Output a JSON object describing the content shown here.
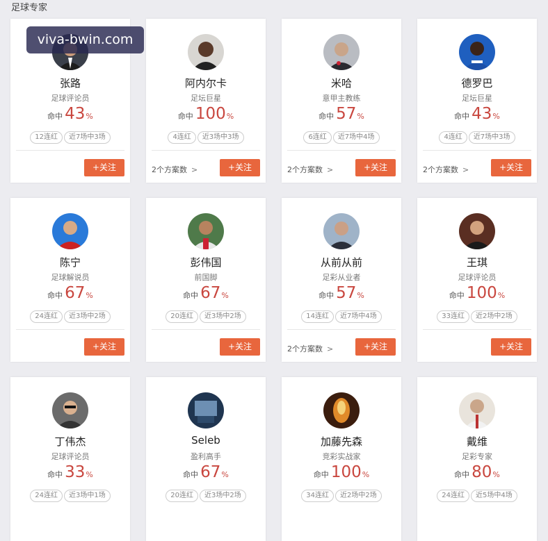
{
  "section_title": "足球专家",
  "watermark": "viva-bwin.com",
  "labels": {
    "hit": "命中",
    "percent": "%",
    "follow": "+关注",
    "plans_suffix": "个方案数"
  },
  "colors": {
    "accent_orange": "#e8663d",
    "rate_red": "#c9473f"
  },
  "experts": [
    {
      "name": "张路",
      "role": "足球评论员",
      "rate": "43",
      "streak": "12连红",
      "recent": "近7场中3场",
      "plans": ""
    },
    {
      "name": "阿内尔卡",
      "role": "足坛巨星",
      "rate": "100",
      "streak": "4连红",
      "recent": "近3场中3场",
      "plans": "2个方案数"
    },
    {
      "name": "米哈",
      "role": "意甲主教练",
      "rate": "57",
      "streak": "6连红",
      "recent": "近7场中4场",
      "plans": "2个方案数"
    },
    {
      "name": "德罗巴",
      "role": "足坛巨星",
      "rate": "43",
      "streak": "4连红",
      "recent": "近7场中3场",
      "plans": "2个方案数"
    },
    {
      "name": "陈宁",
      "role": "足球解说员",
      "rate": "67",
      "streak": "24连红",
      "recent": "近3场中2场",
      "plans": ""
    },
    {
      "name": "彭伟国",
      "role": "前国脚",
      "rate": "67",
      "streak": "20连红",
      "recent": "近3场中2场",
      "plans": ""
    },
    {
      "name": "从前从前",
      "role": "足彩从业者",
      "rate": "57",
      "streak": "14连红",
      "recent": "近7场中4场",
      "plans": "2个方案数"
    },
    {
      "name": "王琪",
      "role": "足球评论员",
      "rate": "100",
      "streak": "33连红",
      "recent": "近2场中2场",
      "plans": ""
    },
    {
      "name": "丁伟杰",
      "role": "足球评论员",
      "rate": "33",
      "streak": "24连红",
      "recent": "近3场中1场",
      "plans": ""
    },
    {
      "name": "Seleb",
      "role": "盈利高手",
      "rate": "67",
      "streak": "20连红",
      "recent": "近3场中2场",
      "plans": ""
    },
    {
      "name": "加藤先森",
      "role": "竞彩实战家",
      "rate": "100",
      "streak": "34连红",
      "recent": "近2场中2场",
      "plans": ""
    },
    {
      "name": "戴维",
      "role": "足彩专家",
      "rate": "80",
      "streak": "24连红",
      "recent": "近5场中4场",
      "plans": ""
    }
  ]
}
